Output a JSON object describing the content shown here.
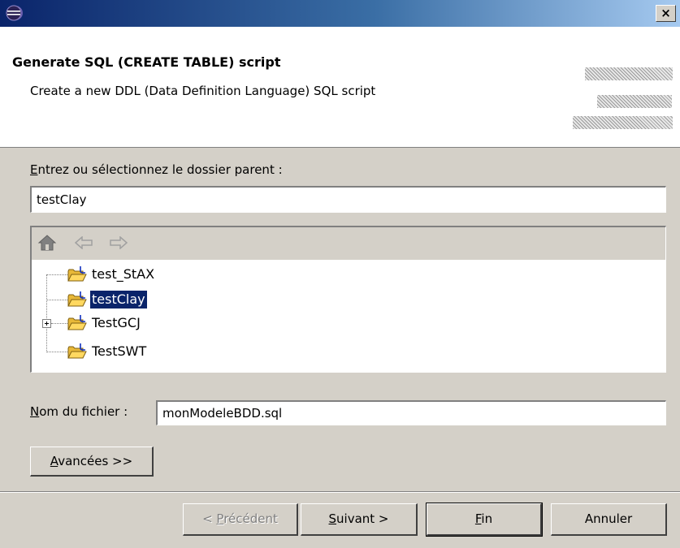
{
  "window": {
    "title": "",
    "close_glyph": "×",
    "icon": "eclipse-icon"
  },
  "banner": {
    "title": "Generate SQL (CREATE TABLE) script",
    "description": "Create a new DDL (Data Definition Language) SQL script"
  },
  "parent_folder": {
    "label_accel": "E",
    "label_rest": "ntrez ou sélectionnez le dossier parent :",
    "value": "testClay"
  },
  "tree": {
    "toolbar": [
      "home-icon",
      "back-arrow-icon",
      "forward-arrow-icon"
    ],
    "items": [
      {
        "label": "test_StAX",
        "selected": false,
        "expandable": false
      },
      {
        "label": "testClay",
        "selected": true,
        "expandable": false
      },
      {
        "label": "TestGCJ",
        "selected": false,
        "expandable": true
      },
      {
        "label": "TestSWT",
        "selected": false,
        "expandable": false
      }
    ]
  },
  "file_name": {
    "label_accel": "N",
    "label_rest": "om du fichier :",
    "value": "monModeleBDD.sql"
  },
  "advanced_button": {
    "accel": "A",
    "rest": "vancées >>"
  },
  "footer": {
    "back": {
      "pre": "< ",
      "accel": "P",
      "rest": "récédent"
    },
    "next": {
      "accel": "S",
      "rest": "uivant >"
    },
    "finish": {
      "accel": "F",
      "rest": "in"
    },
    "cancel": {
      "label": "Annuler"
    }
  },
  "colors": {
    "title_gradient_start": "#0a246a",
    "title_gradient_end": "#a6caf0",
    "selection": "#0a246a",
    "dialog_bg": "#d4d0c8"
  }
}
